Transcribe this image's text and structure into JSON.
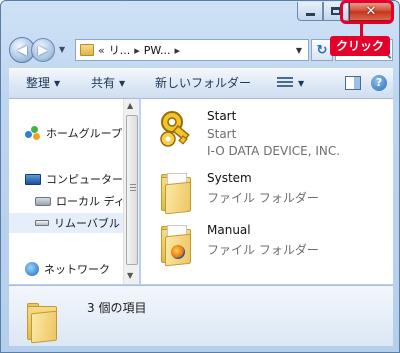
{
  "window": {
    "minimize_icon": "minimize-icon",
    "maximize_icon": "maximize-icon",
    "close_icon": "close-icon",
    "close_glyph": "✕"
  },
  "callout": {
    "label": "クリック",
    "color": "#e4002b"
  },
  "nav": {
    "back_glyph": "◀",
    "forward_glyph": "▶",
    "breadcrumb": [
      "«",
      "リ...",
      "▸",
      "PW...",
      "▸"
    ],
    "refresh_glyph": "↻"
  },
  "toolbar": {
    "organize": "整理",
    "share": "共有",
    "new_folder": "新しいフォルダー",
    "help": "?"
  },
  "sidebar": {
    "items": [
      {
        "label": "ホームグループ",
        "icon": "homegroup-icon"
      },
      {
        "label": "コンピューター",
        "icon": "computer-icon"
      },
      {
        "label": "ローカル ディ",
        "icon": "local-disk-icon"
      },
      {
        "label": "リムーバブル",
        "icon": "removable-disk-icon"
      },
      {
        "label": "ネットワーク",
        "icon": "network-icon"
      }
    ]
  },
  "files": [
    {
      "name": "Start",
      "line2": "Start",
      "line3": "I-O DATA DEVICE, INC.",
      "icon": "key-app-icon"
    },
    {
      "name": "System",
      "line2": "ファイル フォルダー",
      "icon": "folder-icon"
    },
    {
      "name": "Manual",
      "line2": "ファイル フォルダー",
      "icon": "firefox-folder-icon"
    }
  ],
  "status": {
    "text": "3 個の項目"
  },
  "colors": {
    "accent": "#1e395b",
    "close": "#c4341c"
  }
}
